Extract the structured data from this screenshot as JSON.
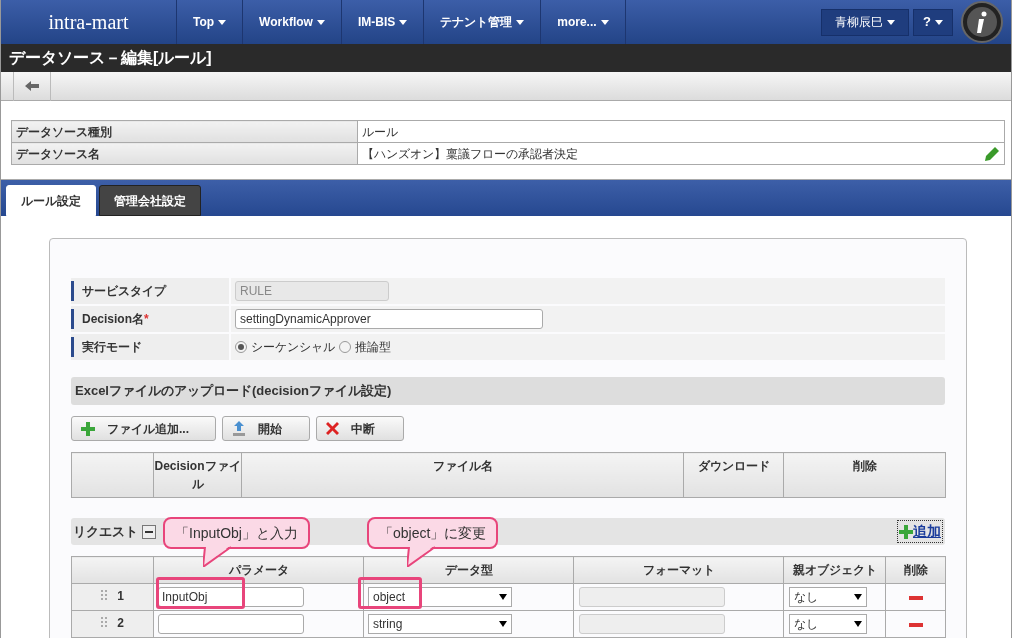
{
  "header": {
    "logo": "intra-mart",
    "menu": [
      {
        "label": "Top"
      },
      {
        "label": "Workflow"
      },
      {
        "label": "IM-BIS"
      },
      {
        "label": "テナント管理"
      },
      {
        "label": "more..."
      }
    ],
    "user": "青柳辰巳",
    "help": "?"
  },
  "page_title": "データソース－編集[ルール]",
  "info": [
    {
      "label": "データソース種別",
      "value": "ルール",
      "editable": false
    },
    {
      "label": "データソース名",
      "value": "【ハンズオン】稟議フローの承認者決定",
      "editable": true
    }
  ],
  "tabs": [
    {
      "label": "ルール設定",
      "selected": true
    },
    {
      "label": "管理会社設定",
      "selected": false
    }
  ],
  "form": {
    "service_type": {
      "label": "サービスタイプ",
      "value": "RULE"
    },
    "decision_name": {
      "label": "Decision名",
      "required_mark": "*",
      "value": "settingDynamicApprover"
    },
    "mode": {
      "label": "実行モード",
      "options": [
        {
          "label": "シーケンシャル",
          "selected": true
        },
        {
          "label": "推論型",
          "selected": false
        }
      ]
    }
  },
  "upload": {
    "title": "Excelファイルのアップロード(decisionファイル設定)",
    "buttons": [
      {
        "kind": "add",
        "label": "ファイル追加..."
      },
      {
        "kind": "upload",
        "label": "開始"
      },
      {
        "kind": "cancel",
        "label": "中断"
      }
    ],
    "columns": [
      "",
      "Decisionファイル",
      "ファイル名",
      "ダウンロード",
      "削除"
    ]
  },
  "request": {
    "title": "リクエスト",
    "add": "追加",
    "columns": [
      "",
      "パラメータ",
      "データ型",
      "フォーマット",
      "親オブジェクト",
      "削除"
    ],
    "rows": [
      {
        "number": "1",
        "parameter": "InputObj",
        "type": "object",
        "parent": "なし",
        "highlighted": true
      },
      {
        "number": "2",
        "parameter": "",
        "type": "string",
        "parent": "なし",
        "highlighted": false
      }
    ]
  },
  "callouts": [
    {
      "text": "「InputObj」と入力"
    },
    {
      "text": "「object」に変更"
    }
  ]
}
